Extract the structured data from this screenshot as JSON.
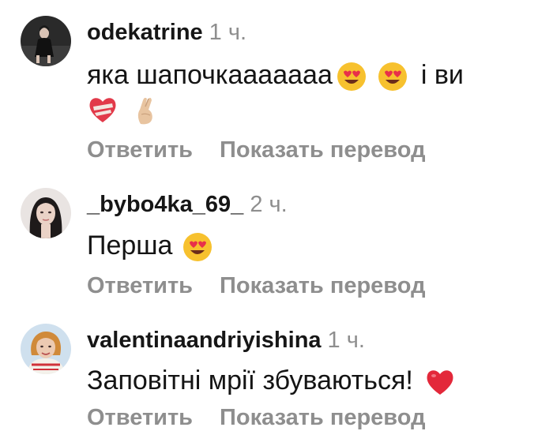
{
  "comments": [
    {
      "username": "odekatrine",
      "time": "1 ч.",
      "text_line1": "яка шапочкаааааaa",
      "text_after_emoji": "і ви",
      "reply_label": "Ответить",
      "translate_label": "Показать перевод",
      "emojis": [
        "heart-eyes-emoji",
        "heart-eyes-emoji",
        "mending-heart-emoji",
        "crossed-fingers-emoji"
      ]
    },
    {
      "username": "_bybo4ka_69_",
      "time": "2 ч.",
      "text": "Перша",
      "reply_label": "Ответить",
      "translate_label": "Показать перевод",
      "emojis": [
        "heart-eyes-emoji"
      ]
    },
    {
      "username": "valentinaandriyishina",
      "time": "1 ч.",
      "text": "Заповітні мрії збуваються!",
      "reply_label": "Ответить",
      "translate_label": "Показать перевод",
      "emojis": [
        "red-heart-emoji"
      ]
    }
  ],
  "colors": {
    "username": "#161616",
    "muted": "#8e8e8e",
    "text": "#141414",
    "background": "#ffffff"
  }
}
